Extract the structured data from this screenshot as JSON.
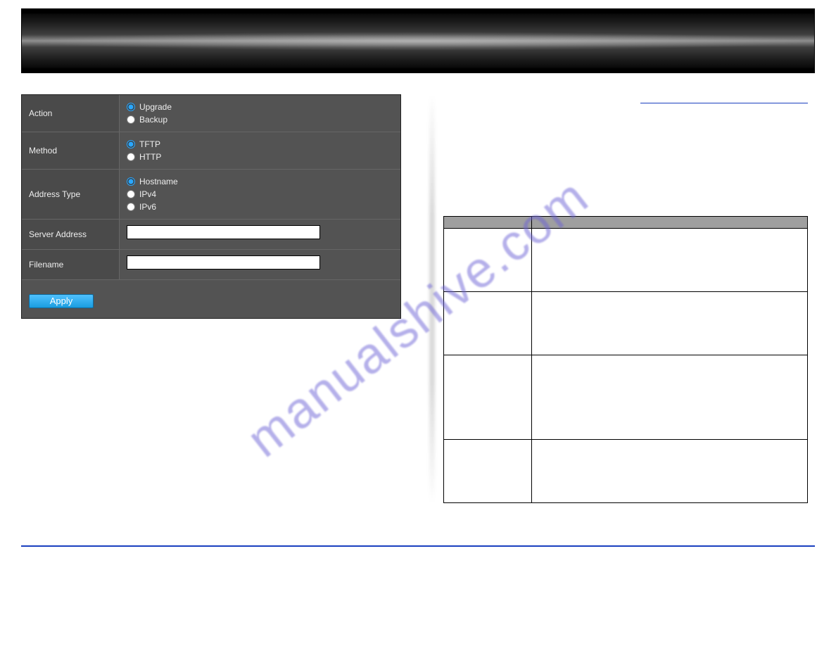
{
  "watermark": "manualshive.com",
  "header_link": " ",
  "config": {
    "rows": {
      "action": {
        "label": "Action",
        "options": [
          {
            "name": "radio-action-upgrade",
            "label": "Upgrade",
            "checked": true
          },
          {
            "name": "radio-action-backup",
            "label": "Backup",
            "checked": false
          }
        ]
      },
      "method": {
        "label": "Method",
        "options": [
          {
            "name": "radio-method-tftp",
            "label": "TFTP",
            "checked": true
          },
          {
            "name": "radio-method-http",
            "label": "HTTP",
            "checked": false
          }
        ]
      },
      "address_type": {
        "label": "Address Type",
        "options": [
          {
            "name": "radio-addrtype-hostname",
            "label": "Hostname",
            "checked": true
          },
          {
            "name": "radio-addrtype-ipv4",
            "label": "IPv4",
            "checked": false
          },
          {
            "name": "radio-addrtype-ipv6",
            "label": "IPv6",
            "checked": false
          }
        ]
      },
      "server_address": {
        "label": "Server Address",
        "value": ""
      },
      "filename": {
        "label": "Filename",
        "value": ""
      }
    },
    "apply_label": "Apply"
  },
  "right_table": {
    "headers": [
      "",
      ""
    ],
    "rows": [
      {
        "field": "",
        "desc": ""
      },
      {
        "field": "",
        "desc": ""
      },
      {
        "field": "",
        "desc": ""
      },
      {
        "field": "",
        "desc": ""
      }
    ]
  },
  "footer": {
    "left": "",
    "right": ""
  }
}
